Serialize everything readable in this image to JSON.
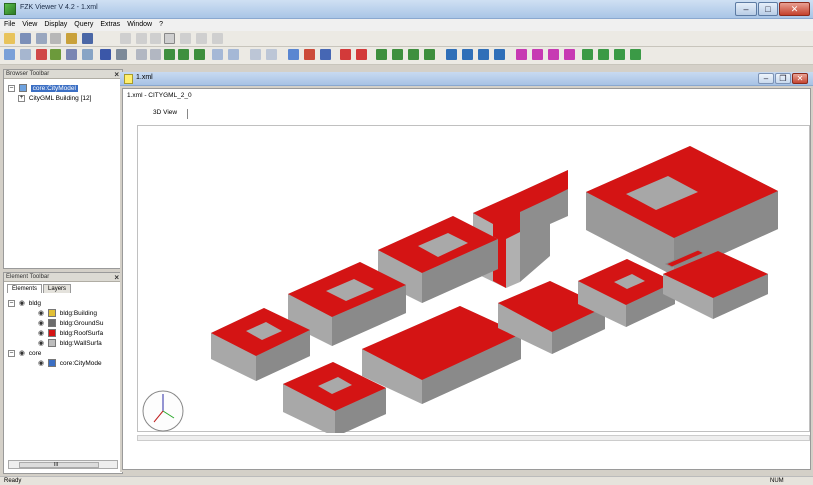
{
  "window": {
    "title": "FZK Viewer V 4.2 - 1.xml",
    "min": "–",
    "max": "□",
    "close": "✕"
  },
  "menu": [
    "File",
    "View",
    "Display",
    "Query",
    "Extras",
    "Window",
    "?"
  ],
  "browser": {
    "title": "Browser Toolbar",
    "close": "×",
    "root": "core:CityModel",
    "child": "CityGML Building [12]"
  },
  "element_toolbar": {
    "title": "Element Toolbar",
    "close": "×",
    "tabs": [
      "Elements",
      "Layers"
    ],
    "groups": [
      {
        "label": "bldg",
        "items": [
          "bldg:Building",
          "bldg:GroundSu",
          "bldg:RoofSurfa",
          "bldg:WallSurfa"
        ]
      },
      {
        "label": "core",
        "items": [
          "core:CityMode"
        ]
      }
    ],
    "scroll_thumb": "III"
  },
  "document": {
    "title": "1.xml",
    "header": "1.xml - CITYGML_2_0",
    "view_tab": "3D View"
  },
  "statusbar": {
    "left": "Ready",
    "right": "NUM"
  },
  "colors": {
    "roof": "#d41414",
    "wall_light": "#b5b5b5",
    "wall_dark": "#8e8e8e"
  }
}
